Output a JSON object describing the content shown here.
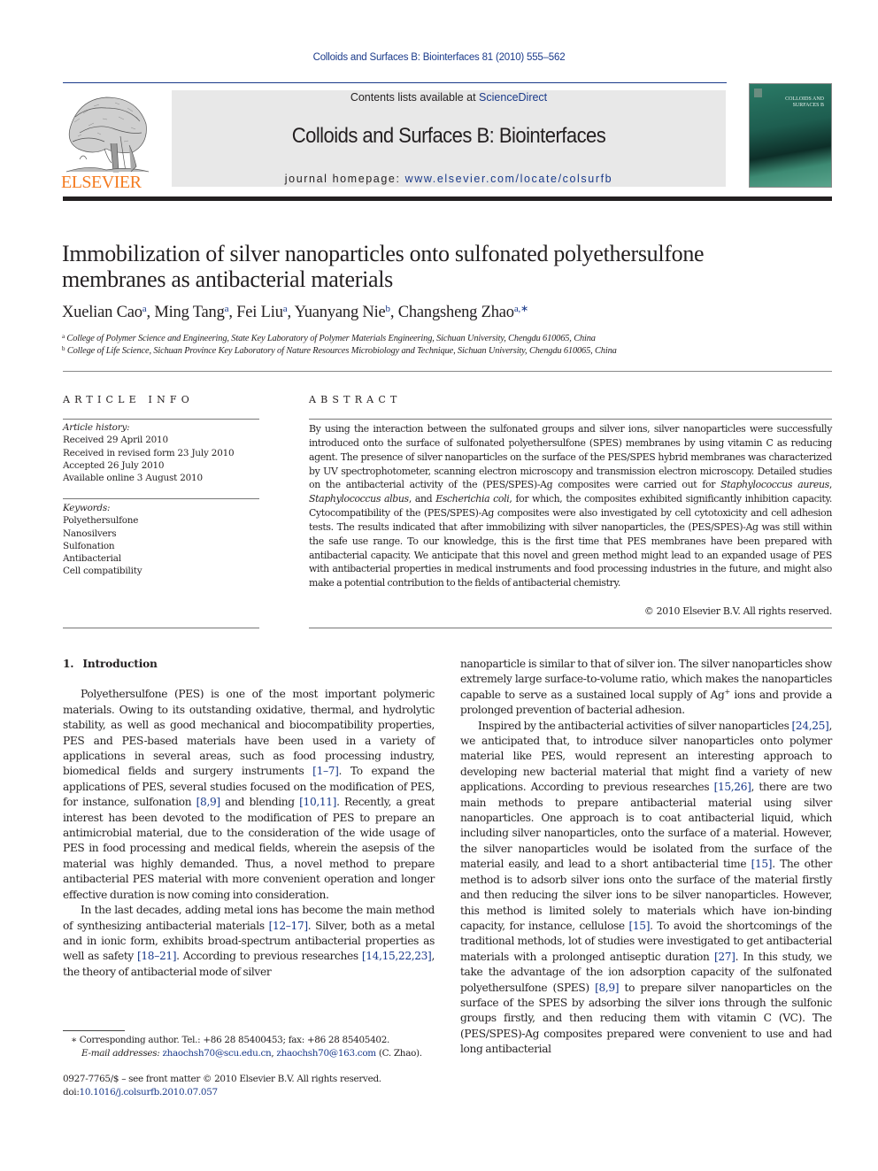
{
  "running_header": "Colloids and Surfaces B: Biointerfaces 81 (2010) 555–562",
  "masthead": {
    "publisher": "ELSEVIER",
    "contents_prefix": "Contents lists available at ",
    "contents_link": "ScienceDirect",
    "journal_title": "Colloids and Surfaces B: Biointerfaces",
    "homepage_prefix": "journal homepage: ",
    "homepage_link": "www.elsevier.com/locate/colsurfb",
    "cover_title_line1": "COLLOIDS AND",
    "cover_title_line2": "SURFACES B"
  },
  "article": {
    "title_line1": "Immobilization of silver nanoparticles onto sulfonated polyethersulfone",
    "title_line2": "membranes as antibacterial materials",
    "authors": [
      {
        "name": "Xuelian Cao",
        "sup": "a",
        "sep": ", "
      },
      {
        "name": "Ming Tang",
        "sup": "a",
        "sep": ", "
      },
      {
        "name": "Fei Liu",
        "sup": "a",
        "sep": ", "
      },
      {
        "name": "Yuanyang Nie",
        "sup": "b",
        "sep": ", "
      },
      {
        "name": "Changsheng Zhao",
        "sup": "a,∗",
        "sep": ""
      }
    ],
    "affiliations": [
      {
        "mark": "a",
        "text": "College of Polymer Science and Engineering, State Key Laboratory of Polymer Materials Engineering, Sichuan University, Chengdu 610065, China"
      },
      {
        "mark": "b",
        "text": "College of Life Science, Sichuan Province Key Laboratory of Nature Resources Microbiology and Technique, Sichuan University, Chengdu 610065, China"
      }
    ]
  },
  "article_info": {
    "heading": "ARTICLE INFO",
    "history_label": "Article history:",
    "history": [
      "Received 29 April 2010",
      "Received in revised form 23 July 2010",
      "Accepted 26 July 2010",
      "Available online 3 August 2010"
    ],
    "keywords_label": "Keywords:",
    "keywords": [
      "Polyethersulfone",
      "Nanosilvers",
      "Sulfonation",
      "Antibacterial",
      "Cell compatibility"
    ]
  },
  "abstract": {
    "heading": "ABSTRACT",
    "part1": "By using the interaction between the sulfonated groups and silver ions, silver nanoparticles were successfully introduced onto the surface of sulfonated polyethersulfone (SPES) membranes by using vitamin C as reducing agent. The presence of silver nanoparticles on the surface of the PES/SPES hybrid membranes was characterized by UV spectrophotometer, scanning electron microscopy and transmission electron microscopy. Detailed studies on the antibacterial activity of the (PES/SPES)-Ag composites were carried out for ",
    "species1": "Staphylococcus aureus",
    "sep1": ", ",
    "species2": "Staphylococcus albus",
    "sep2": ", and ",
    "species3": "Escherichia coli",
    "part2": ", for which, the composites exhibited significantly inhibition capacity. Cytocompatibility of the (PES/SPES)-Ag composites were also investigated by cell cytotoxicity and cell adhesion tests. The results indicated that after immobilizing with silver nanoparticles, the (PES/SPES)-Ag was still within the safe use range. To our knowledge, this is the first time that PES membranes have been prepared with antibacterial capacity. We anticipate that this novel and green method might lead to an expanded usage of PES with antibacterial properties in medical instruments and food processing industries in the future, and might also make a potential contribution to the fields of antibacterial chemistry.",
    "copyright": "© 2010 Elsevier B.V. All rights reserved."
  },
  "introduction": {
    "number": "1.",
    "heading": "Introduction",
    "p1": {
      "t1": "Polyethersulfone (PES) is one of the most important polymeric materials. Owing to its outstanding oxidative, thermal, and hydrolytic stability, as well as good mechanical and biocompatibility properties, PES and PES-based materials have been used in a variety of applications in several areas, such as food processing industry, biomedical fields and surgery instruments ",
      "c1": "[1–7]",
      "t2": ". To expand the applications of PES, several studies focused on the modification of PES, for instance, sulfonation ",
      "c2": "[8,9]",
      "t3": " and blending ",
      "c3": "[10,11]",
      "t4": ". Recently, a great interest has been devoted to the modification of PES to prepare an antimicrobial material, due to the consideration of the wide usage of PES in food processing and medical fields, wherein the asepsis of the material was highly demanded. Thus, a novel method to prepare antibacterial PES material with more convenient operation and longer effective duration is now coming into consideration."
    },
    "p2": {
      "t1": "In the last decades, adding metal ions has become the main method of synthesizing antibacterial materials ",
      "c1": "[12–17]",
      "t2": ". Silver, both as a metal and in ionic form, exhibits broad-spectrum antibacterial properties as well as safety ",
      "c2": "[18–21]",
      "t3": ". According to previous researches ",
      "c3": "[14,15,22,23]",
      "t4": ", the theory of antibacterial mode of silver"
    },
    "p3": {
      "t1": "nanoparticle is similar to that of silver ion. The silver nanoparticles show extremely large surface-to-volume ratio, which makes the nanoparticles capable to serve as a sustained local supply of Ag",
      "sup": "+",
      "t2": " ions and provide a prolonged prevention of bacterial adhesion."
    },
    "p4": {
      "t1": "Inspired by the antibacterial activities of silver nanoparticles ",
      "c1": "[24,25]",
      "t2": ", we anticipated that, to introduce silver nanoparticles onto polymer material like PES, would represent an interesting approach to developing new bacterial material that might find a variety of new applications. According to previous researches ",
      "c2": "[15,26]",
      "t3": ", there are two main methods to prepare antibacterial material using silver nanoparticles. One approach is to coat antibacterial liquid, which including silver nanoparticles, onto the surface of a material. However, the silver nanoparticles would be isolated from the surface of the material easily, and lead to a short antibacterial time ",
      "c3": "[15]",
      "t4": ". The other method is to adsorb silver ions onto the surface of the material firstly and then reducing the silver ions to be silver nanoparticles. However, this method is limited solely to materials which have ion-binding capacity, for instance, cellulose ",
      "c4": "[15]",
      "t5": ". To avoid the shortcomings of the traditional methods, lot of studies were investigated to get antibacterial materials with a prolonged antiseptic duration ",
      "c5": "[27]",
      "t6": ". In this study, we take the advantage of the ion adsorption capacity of the sulfonated polyethersulfone (SPES) ",
      "c6": "[8,9]",
      "t7": " to prepare silver nanoparticles on the surface of the SPES by adsorbing the silver ions through the sulfonic groups firstly, and then reducing them with vitamin C (VC). The (PES/SPES)-Ag composites prepared were convenient to use and had long antibacterial"
    }
  },
  "footnote": {
    "star": "∗",
    "corresponding": " Corresponding author. Tel.: +86 28 85400453; fax: +86 28 85405402.",
    "email_label": "E-mail addresses:",
    "email1": "zhaochsh70@scu.edu.cn",
    "email_sep": ", ",
    "email2": "zhaochsh70@163.com",
    "email_suffix": " (C. Zhao)."
  },
  "front_matter": {
    "issn_line": "0927-7765/$ – see front matter © 2010 Elsevier B.V. All rights reserved.",
    "doi_prefix": "doi:",
    "doi_link": "10.1016/j.colsurfb.2010.07.057"
  },
  "colors": {
    "link": "#1a3a8a",
    "elsevier_orange": "#f47b20",
    "masthead_gray": "#e8e8e8",
    "text": "#231f20"
  }
}
